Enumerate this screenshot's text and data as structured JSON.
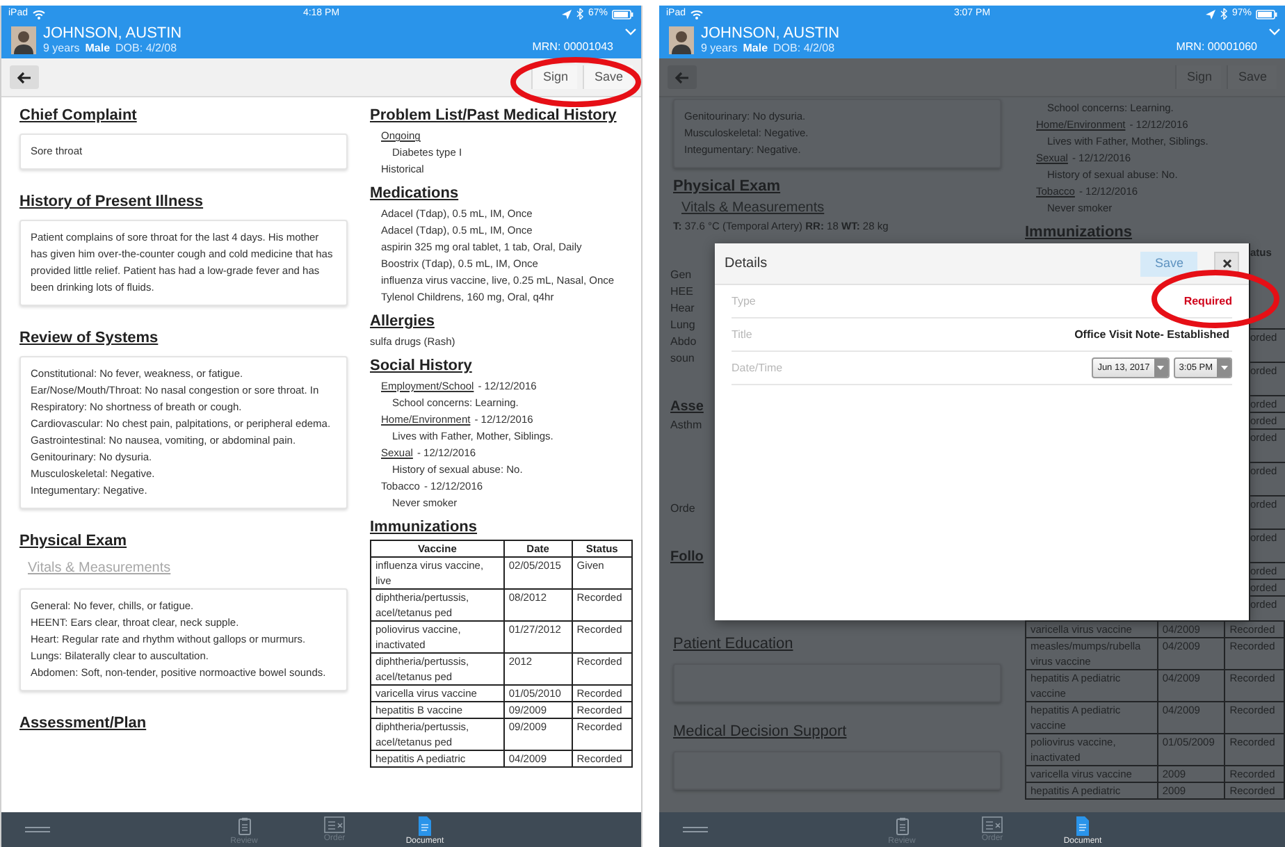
{
  "screens": [
    {
      "kind": "document",
      "highlight": true,
      "status_bar": {
        "carrier": "iPad",
        "time": "4:18 PM",
        "battery": "67%"
      },
      "patient": {
        "name": "JOHNSON, AUSTIN",
        "age": "9 years",
        "sex": "Male",
        "dob": "DOB: 4/2/08",
        "mrn": "MRN: 00001043"
      },
      "toolbar": {
        "buttons": [
          "Sign",
          "Save"
        ]
      },
      "left_column": [
        {
          "kind": "heading",
          "text": "Chief Complaint"
        },
        {
          "kind": "card",
          "lines": [
            "Sore throat"
          ]
        },
        {
          "kind": "heading",
          "text": "History of Present Illness"
        },
        {
          "kind": "card",
          "lines": [
            "Patient complains of sore throat for the last 4 days. His mother has given him over-the-counter cough and cold medicine that has provided little relief. Patient has had a low-grade fever and has been drinking lots of fluids."
          ]
        },
        {
          "kind": "heading",
          "text": "Review of Systems"
        },
        {
          "kind": "card",
          "lines": [
            "Constitutional: No fever, weakness, or fatigue.",
            "Ear/Nose/Mouth/Throat: No nasal congestion or sore throat. In",
            "Respiratory: No shortness of breath or cough.",
            "Cardiovascular: No chest pain, palpitations, or peripheral edema.",
            "Gastrointestinal: No nausea, vomiting, or abdominal pain.",
            "Genitourinary: No dysuria.",
            "Musculoskeletal: Negative.",
            "Integumentary: Negative."
          ]
        },
        {
          "kind": "heading",
          "text": "Physical Exam"
        },
        {
          "kind": "link",
          "text": "Vitals & Measurements"
        },
        {
          "kind": "card",
          "lines": [
            "General: No fever, chills, or fatigue.",
            "HEENT: Ears clear, throat clear, neck supple.",
            "Heart: Regular rate and rhythm without gallops or murmurs.",
            "Lungs: Bilaterally clear to auscultation.",
            "Abdomen: Soft, non-tender, positive normoactive bowel sounds."
          ]
        },
        {
          "kind": "heading",
          "text": "Assessment/Plan"
        }
      ],
      "right_column": [
        {
          "kind": "heading",
          "text": "Problem List/Past Medical History"
        },
        {
          "kind": "sublink",
          "text": "Ongoing"
        },
        {
          "kind": "sub",
          "text": "Diabetes type I"
        },
        {
          "kind": "item",
          "text": "Historical"
        },
        {
          "kind": "heading",
          "text": "Medications"
        },
        {
          "kind": "med",
          "text": "Adacel (Tdap), 0.5 mL, IM, Once"
        },
        {
          "kind": "med",
          "text": "Adacel (Tdap), 0.5 mL, IM, Once"
        },
        {
          "kind": "med",
          "text": "aspirin 325 mg oral tablet, 1 tab, Oral, Daily"
        },
        {
          "kind": "med",
          "text": "Boostrix (Tdap), 0.5 mL, IM, Once"
        },
        {
          "kind": "med",
          "text": "influenza virus vaccine, live, 0.25 mL, Nasal, Once"
        },
        {
          "kind": "med",
          "text": "Tylenol Childrens, 160 mg, Oral, q4hr"
        },
        {
          "kind": "heading",
          "text": "Allergies"
        },
        {
          "kind": "plain",
          "text": "sulfa drugs (Rash)"
        },
        {
          "kind": "heading",
          "text": "Social History"
        },
        {
          "kind": "dated",
          "label": "Employment/School",
          "date": "- 12/12/2016",
          "underlined": true
        },
        {
          "kind": "sub",
          "text": "School concerns: Learning."
        },
        {
          "kind": "dated",
          "label": "Home/Environment",
          "date": "- 12/12/2016",
          "underlined": true
        },
        {
          "kind": "sub",
          "text": "Lives with Father, Mother, Siblings."
        },
        {
          "kind": "dated",
          "label": "Sexual",
          "date": "- 12/12/2016",
          "underlined": true
        },
        {
          "kind": "sub",
          "text": "History of sexual abuse: No."
        },
        {
          "kind": "dated",
          "label": "Tobacco",
          "date": "- 12/12/2016",
          "underlined": false
        },
        {
          "kind": "sub",
          "text": "Never smoker"
        },
        {
          "kind": "heading",
          "text": "Immunizations"
        },
        {
          "kind": "table",
          "columns": [
            "Vaccine",
            "Date",
            "Status"
          ],
          "rows": [
            [
              "influenza virus vaccine, live",
              "02/05/2015",
              "Given"
            ],
            [
              "diphtheria/pertussis, acel/tetanus ped",
              "08/2012",
              "Recorded"
            ],
            [
              "poliovirus vaccine, inactivated",
              "01/27/2012",
              "Recorded"
            ],
            [
              "diphtheria/pertussis, acel/tetanus ped",
              "2012",
              "Recorded"
            ],
            [
              "varicella virus vaccine",
              "01/05/2010",
              "Recorded"
            ],
            [
              "hepatitis B vaccine",
              "09/2009",
              "Recorded"
            ],
            [
              "diphtheria/pertussis, acel/tetanus ped",
              "09/2009",
              "Recorded"
            ],
            [
              "hepatitis A pediatric",
              "04/2009",
              "Recorded"
            ]
          ]
        }
      ],
      "tabs": [
        {
          "kind": "review",
          "label": "Review",
          "selected": false
        },
        {
          "kind": "order",
          "label": "Order",
          "selected": false
        },
        {
          "kind": "document",
          "label": "Document",
          "selected": true
        }
      ]
    },
    {
      "kind": "dialog",
      "highlight": true,
      "status_bar": {
        "carrier": "iPad",
        "time": "3:07 PM",
        "battery": "97%"
      },
      "patient": {
        "name": "JOHNSON, AUSTIN",
        "age": "9 years",
        "sex": "Male",
        "dob": "DOB: 4/2/08",
        "mrn": "MRN: 00001060"
      },
      "toolbar": {
        "buttons": [
          "Sign",
          "Save"
        ]
      },
      "top_left": [
        {
          "kind": "card",
          "lines": [
            "Genitourinary: No dysuria.",
            "Musculoskeletal: Negative.",
            "Integumentary: Negative."
          ]
        },
        {
          "kind": "heading",
          "text": "Physical Exam"
        },
        {
          "kind": "link",
          "text": "Vitals & Measurements"
        },
        {
          "kind": "vitals",
          "text": "**T:** 37.6 °C (Temporal Artery) **RR:** 18 **WT:** 28 kg"
        }
      ],
      "top_right": [
        {
          "kind": "sub",
          "text": "School concerns: Learning."
        },
        {
          "kind": "dated",
          "label": "Home/Environment",
          "date": "- 12/12/2016",
          "underlined": true
        },
        {
          "kind": "sub",
          "text": "Lives with Father, Mother, Siblings."
        },
        {
          "kind": "dated",
          "label": "Sexual",
          "date": "- 12/12/2016",
          "underlined": true
        },
        {
          "kind": "sub",
          "text": "History of sexual abuse: No."
        },
        {
          "kind": "dated",
          "label": "Tobacco",
          "date": "- 12/12/2016",
          "underlined": true
        },
        {
          "kind": "sub",
          "text": "Never smoker"
        },
        {
          "kind": "heading",
          "text": "Immunizations"
        }
      ],
      "band_left": [
        {
          "kind": "text",
          "text": "Gen"
        },
        {
          "kind": "text",
          "text": "HEE"
        },
        {
          "kind": "text",
          "text": "Hear"
        },
        {
          "kind": "text",
          "text": "Lung"
        },
        {
          "kind": "text",
          "text": "Abdo"
        },
        {
          "kind": "text",
          "text": "soun"
        },
        {
          "kind": "heading",
          "text": "Asse"
        },
        {
          "kind": "text",
          "text": "Asthm"
        },
        {
          "kind": "boxed",
          "text": "Orde"
        },
        {
          "kind": "heading",
          "text": "Follo"
        }
      ],
      "dialog": {
        "title": "Details",
        "save_button": {
          "label": "Save",
          "disabled": true
        },
        "fields": [
          {
            "kind": "required",
            "label": "Type",
            "value": "Required"
          },
          {
            "kind": "text",
            "label": "Title",
            "value": "Office Visit Note- Established"
          },
          {
            "kind": "datetime",
            "label": "Date/Time",
            "date": "Jun 13, 2017",
            "time": "3:05 PM"
          }
        ]
      },
      "band_right": [
        {
          "kind": "header",
          "text": "atus"
        },
        {
          "kind": "double",
          "text": "orded"
        },
        {
          "kind": "double",
          "text": "orded"
        },
        {
          "kind": "single",
          "text": "orded"
        },
        {
          "kind": "single",
          "text": "orded"
        },
        {
          "kind": "double",
          "text": "orded"
        },
        {
          "kind": "double",
          "text": "orded"
        },
        {
          "kind": "double",
          "text": "orded"
        },
        {
          "kind": "double",
          "text": "orded"
        },
        {
          "kind": "single",
          "text": "orded"
        },
        {
          "kind": "single",
          "text": "orded"
        },
        {
          "kind": "single",
          "text": "orded"
        }
      ],
      "bottom_left": [
        {
          "kind": "heading-plain",
          "text": "Patient Education"
        },
        {
          "kind": "card"
        },
        {
          "kind": "heading-plain",
          "text": "Medical Decision Support"
        },
        {
          "kind": "card"
        }
      ],
      "bottom_right": [
        {
          "kind": "table",
          "rows": [
            [
              "varicella virus vaccine",
              "04/2009",
              "Recorded"
            ],
            [
              "measles/mumps/rubella virus vaccine",
              "04/2009",
              "Recorded"
            ],
            [
              "hepatitis A pediatric vaccine",
              "04/2009",
              "Recorded"
            ],
            [
              "hepatitis A pediatric vaccine",
              "04/2009",
              "Recorded"
            ],
            [
              "poliovirus vaccine, inactivated",
              "01/05/2009",
              "Recorded"
            ],
            [
              "varicella virus vaccine",
              "2009",
              "Recorded"
            ],
            [
              "hepatitis A pediatric",
              "2009",
              "Recorded"
            ]
          ]
        }
      ],
      "tabs": [
        {
          "kind": "review",
          "label": "Review",
          "selected": false
        },
        {
          "kind": "order",
          "label": "Order",
          "selected": false
        },
        {
          "kind": "document",
          "label": "Document",
          "selected": true
        }
      ]
    }
  ]
}
